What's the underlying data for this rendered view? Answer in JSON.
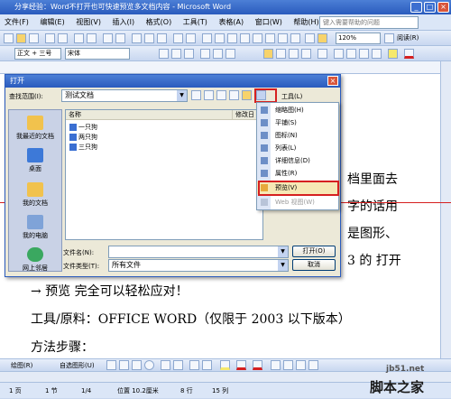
{
  "window": {
    "title": "分享经验：Word不打开也可快速预览多文档内容 - Microsoft Word"
  },
  "menubar": {
    "items": [
      "文件(F)",
      "编辑(E)",
      "视图(V)",
      "插入(I)",
      "格式(O)",
      "工具(T)",
      "表格(A)",
      "窗口(W)",
      "帮助(H)"
    ],
    "help_placeholder": "键入需要帮助的问题"
  },
  "toolbar": {
    "zoom": "120%",
    "read_label": "阅读(R)",
    "style": "正文 + 三号",
    "font": "宋体"
  },
  "document": {
    "line1": "档里面去",
    "line2": "字的话用",
    "line3": "是图形、",
    "line4": "3 的 打开",
    "line5": "→ 预览 完全可以轻松应对！",
    "line6": "工具/原料：OFFICE WORD（仅限于 2003 以下版本）",
    "line7": "方法步骤："
  },
  "dialog": {
    "title": "打开",
    "lookin_label": "查找范围(I):",
    "lookin_value": "测试文档",
    "tools_label": "工具(L)",
    "places": [
      "我最近的文档",
      "桌面",
      "我的文档",
      "我的电脑",
      "网上邻居"
    ],
    "col_name": "名称",
    "col_modified": "修改日",
    "files": [
      "一只狗",
      "两只狗",
      "三只狗"
    ],
    "filename_label": "文件名(N):",
    "filetype_label": "文件类型(T):",
    "filetype_value": "所有文件",
    "open_button": "打开(O)",
    "cancel_button": "取消"
  },
  "views_menu": {
    "items": [
      "缩略图(H)",
      "平铺(S)",
      "图标(N)",
      "列表(L)",
      "详细信息(D)",
      "属性(R)",
      "预览(V)",
      "Web 视图(W)"
    ],
    "highlighted": "预览(V)"
  },
  "drawbar": {
    "draw_label": "绘图(R)",
    "autoshape_label": "自选图形(U)"
  },
  "statusbar": {
    "page": "1 页",
    "section": "1 节",
    "pages": "1/4",
    "pos": "位置 10.2厘米",
    "line": "8 行",
    "col": "15 列"
  },
  "watermark": {
    "site": "jb51.net",
    "name": "脚本之家"
  },
  "colors": {
    "title_blue": "#2a5bbd",
    "highlight_red": "#d62020",
    "menu_bg": "#dbe6f7"
  }
}
